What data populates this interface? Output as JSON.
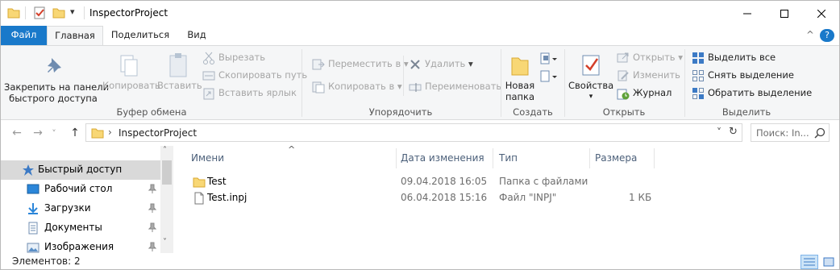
{
  "window": {
    "title": "InspectorProject",
    "minimize_glyph": "—",
    "maximize_glyph": "☐",
    "close_glyph": "✕"
  },
  "quick_access_toolbar": {
    "dropdown_glyph": "▾"
  },
  "tabs": [
    {
      "label": "Файл"
    },
    {
      "label": "Главная"
    },
    {
      "label": "Поделиться"
    },
    {
      "label": "Вид"
    }
  ],
  "ribbon": {
    "collapse_glyph": "^",
    "help_glyph": "?",
    "groups": {
      "clipboard": {
        "label": "Буфер обмена",
        "pin_quick_access": "Закрепить на панели\nбыстрого доступа",
        "copy": "Копировать",
        "paste": "Вставить",
        "cut": "Вырезать",
        "copy_path": "Скопировать путь",
        "paste_shortcut": "Вставить ярлык"
      },
      "organize": {
        "label": "Упорядочить",
        "move_to": "Переместить в",
        "copy_to": "Копировать в",
        "delete": "Удалить",
        "rename": "Переименовать"
      },
      "new": {
        "label": "Создать",
        "new_folder": "Новая\nпапка"
      },
      "open": {
        "label": "Открыть",
        "properties": "Свойства",
        "open": "Открыть",
        "edit": "Изменить",
        "history": "Журнал"
      },
      "select": {
        "label": "Выделить",
        "select_all": "Выделить все",
        "select_none": "Снять выделение",
        "invert_selection": "Обратить выделение"
      }
    }
  },
  "address_bar": {
    "back_glyph": "←",
    "forward_glyph": "→",
    "recent_glyph": "˅",
    "up_glyph": "↑",
    "chevron_glyph": "›",
    "path": "InspectorProject",
    "dropdown_glyph": "˅",
    "refresh_glyph": "↻",
    "search_placeholder": "Поиск: In..."
  },
  "nav_pane": {
    "items": [
      {
        "label": "Быстрый доступ",
        "icon": "star-icon",
        "pinned": false,
        "active": true
      },
      {
        "label": "Рабочий стол",
        "icon": "desktop-icon",
        "pinned": true
      },
      {
        "label": "Загрузки",
        "icon": "download-icon",
        "pinned": true
      },
      {
        "label": "Документы",
        "icon": "documents-icon",
        "pinned": true
      },
      {
        "label": "Изображения",
        "icon": "pictures-icon",
        "pinned": true
      }
    ],
    "scroll_up_glyph": "˄",
    "scroll_down_glyph": "˅"
  },
  "file_list": {
    "sort_glyph": "^",
    "columns": {
      "name": "Имени",
      "date": "Дата изменения",
      "type": "Тип",
      "size": "Размера"
    },
    "rows": [
      {
        "name": "Test",
        "date": "09.04.2018 16:05",
        "type": "Папка с файлами",
        "size": "",
        "icon": "folder-icon"
      },
      {
        "name": "Test.inpj",
        "date": "06.04.2018 15:16",
        "type": "Файл \"INPJ\"",
        "size": "1 КБ",
        "icon": "file-icon"
      }
    ]
  },
  "status_bar": {
    "items_count": "Элементов: 2"
  },
  "colors": {
    "accent": "#1979ca",
    "ribbon_bg": "#f5f6f7",
    "folder": "#f8d775",
    "nav_active": "#d9d9d9"
  }
}
